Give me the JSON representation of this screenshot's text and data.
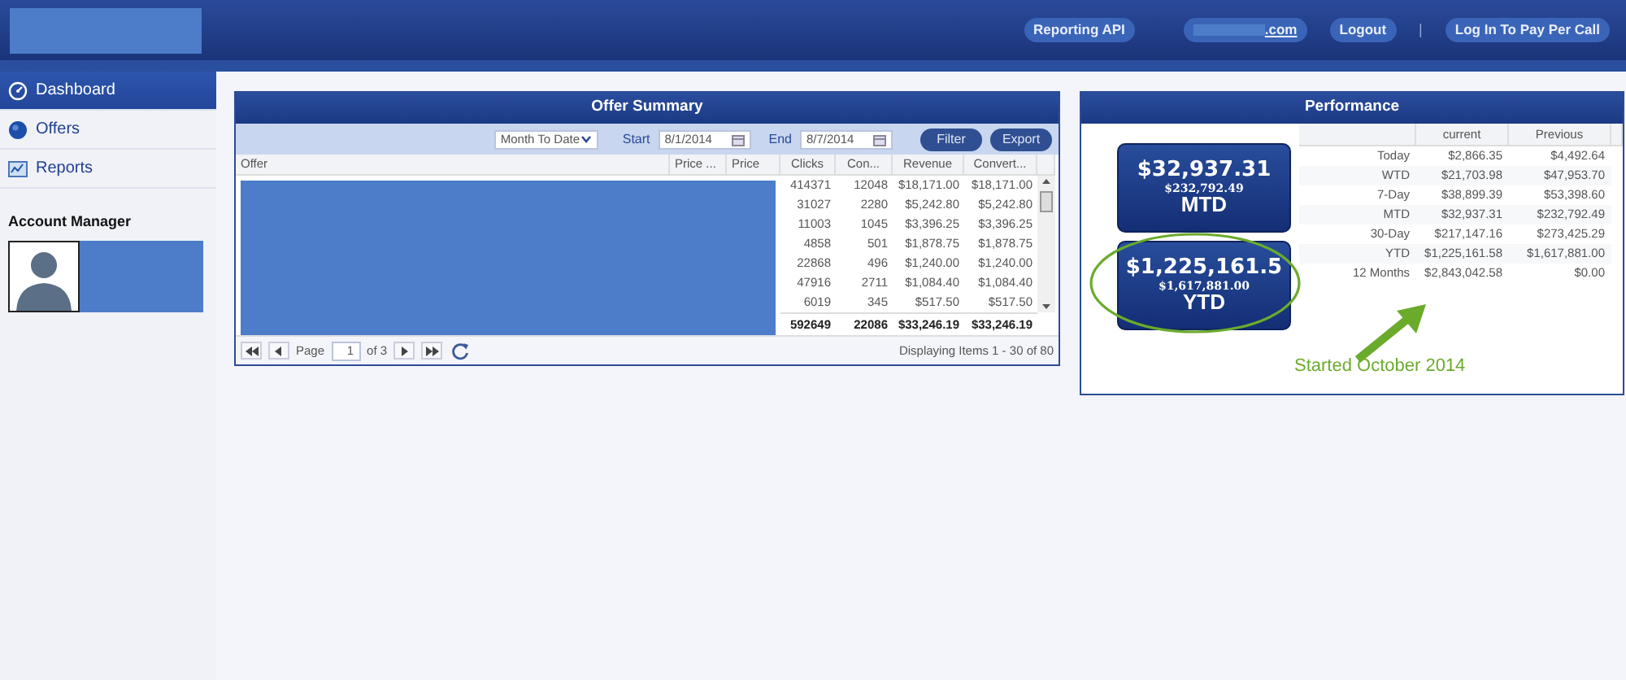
{
  "header": {
    "links": [
      {
        "kind": "pill",
        "label": "Reporting API"
      },
      {
        "kind": "account",
        "label": ".com"
      },
      {
        "kind": "pill",
        "label": "Logout"
      },
      {
        "kind": "separator",
        "label": "|"
      },
      {
        "kind": "pill",
        "label": "Log In To Pay Per Call"
      }
    ]
  },
  "sidebar": {
    "items": [
      {
        "label": "Dashboard",
        "selected": true
      },
      {
        "label": "Offers",
        "selected": false
      },
      {
        "label": "Reports",
        "selected": false
      }
    ],
    "account_manager": {
      "title": "Account Manager"
    }
  },
  "offer_summary": {
    "title": "Offer Summary",
    "range": "Month To Date",
    "start_label": "Start",
    "start": "8/1/2014",
    "end_label": "End",
    "end": "8/7/2014",
    "buttons": [
      "Filter",
      "Export"
    ],
    "columns": [
      "Offer",
      "Price ...",
      "Price",
      "Clicks",
      "Con...",
      "Revenue",
      "Convert..."
    ],
    "rows": [
      [
        "",
        "",
        "",
        "414371",
        "12048",
        "$18,171.00",
        "$18,171.00"
      ],
      [
        "",
        "",
        "",
        "31027",
        "2280",
        "$5,242.80",
        "$5,242.80"
      ],
      [
        "",
        "",
        "",
        "11003",
        "1045",
        "$3,396.25",
        "$3,396.25"
      ],
      [
        "",
        "",
        "",
        "4858",
        "501",
        "$1,878.75",
        "$1,878.75"
      ],
      [
        "",
        "",
        "",
        "22868",
        "496",
        "$1,240.00",
        "$1,240.00"
      ],
      [
        "",
        "",
        "",
        "47916",
        "2711",
        "$1,084.40",
        "$1,084.40"
      ],
      [
        "",
        "",
        "",
        "6019",
        "345",
        "$517.50",
        "$517.50"
      ]
    ],
    "totals": {
      "clicks": "592649",
      "conversions": "22086",
      "revenue": "$33,246.19",
      "converted": "$33,246.19"
    },
    "pager": {
      "page_label": "Page",
      "page": "1",
      "of": "of 3",
      "status": "Displaying Items 1 - 30 of 80"
    }
  },
  "performance": {
    "title": "Performance",
    "tiles": [
      {
        "value": "$32,937.31",
        "sub": "$232,792.49",
        "label": "MTD",
        "circled": false
      },
      {
        "value": "$1,225,161.5",
        "sub": "$1,617,881.00",
        "label": "YTD",
        "circled": true
      }
    ],
    "columns": [
      "",
      "current",
      "Previous"
    ],
    "rows": [
      [
        "Today",
        "$2,866.35",
        "$4,492.64"
      ],
      [
        "WTD",
        "$21,703.98",
        "$47,953.70"
      ],
      [
        "7-Day",
        "$38,899.39",
        "$53,398.60"
      ],
      [
        "MTD",
        "$32,937.31",
        "$232,792.49"
      ],
      [
        "30-Day",
        "$217,147.16",
        "$273,425.29"
      ],
      [
        "YTD",
        "$1,225,161.58",
        "$1,617,881.00"
      ],
      [
        "12 Months",
        "$2,843,042.58",
        "$0.00"
      ]
    ],
    "annotation": "Started October 2014"
  }
}
